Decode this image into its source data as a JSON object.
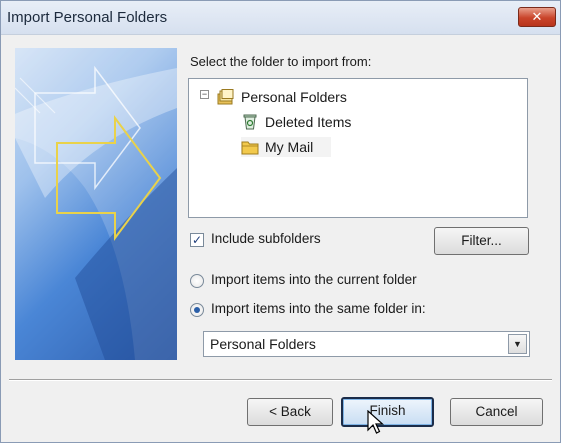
{
  "window": {
    "title": "Import Personal Folders",
    "close_glyph": "✕"
  },
  "main": {
    "prompt": "Select the folder to import from:",
    "tree": [
      {
        "label": "Personal Folders",
        "icon": "personal-folders-icon",
        "expanded": true
      },
      {
        "label": "Deleted Items",
        "icon": "recycle-bin-icon"
      },
      {
        "label": "My Mail",
        "icon": "folder-icon",
        "selected": true
      }
    ],
    "expander_glyph": "−",
    "include_subfolders": {
      "label": "Include subfolders",
      "checked": true,
      "glyph": "✓"
    },
    "filter_button": "Filter...",
    "radio_current": {
      "label": "Import items into the current folder",
      "selected": false
    },
    "radio_same": {
      "label": "Import items into the same folder in:",
      "selected": true
    },
    "target_select": {
      "value": "Personal Folders",
      "arrow_glyph": "▼"
    }
  },
  "footer": {
    "back_button": "< Back",
    "finish_button": "Finish",
    "cancel_button": "Cancel"
  },
  "colors": {
    "accent": "#2b5fa8",
    "close": "#c9442a"
  }
}
